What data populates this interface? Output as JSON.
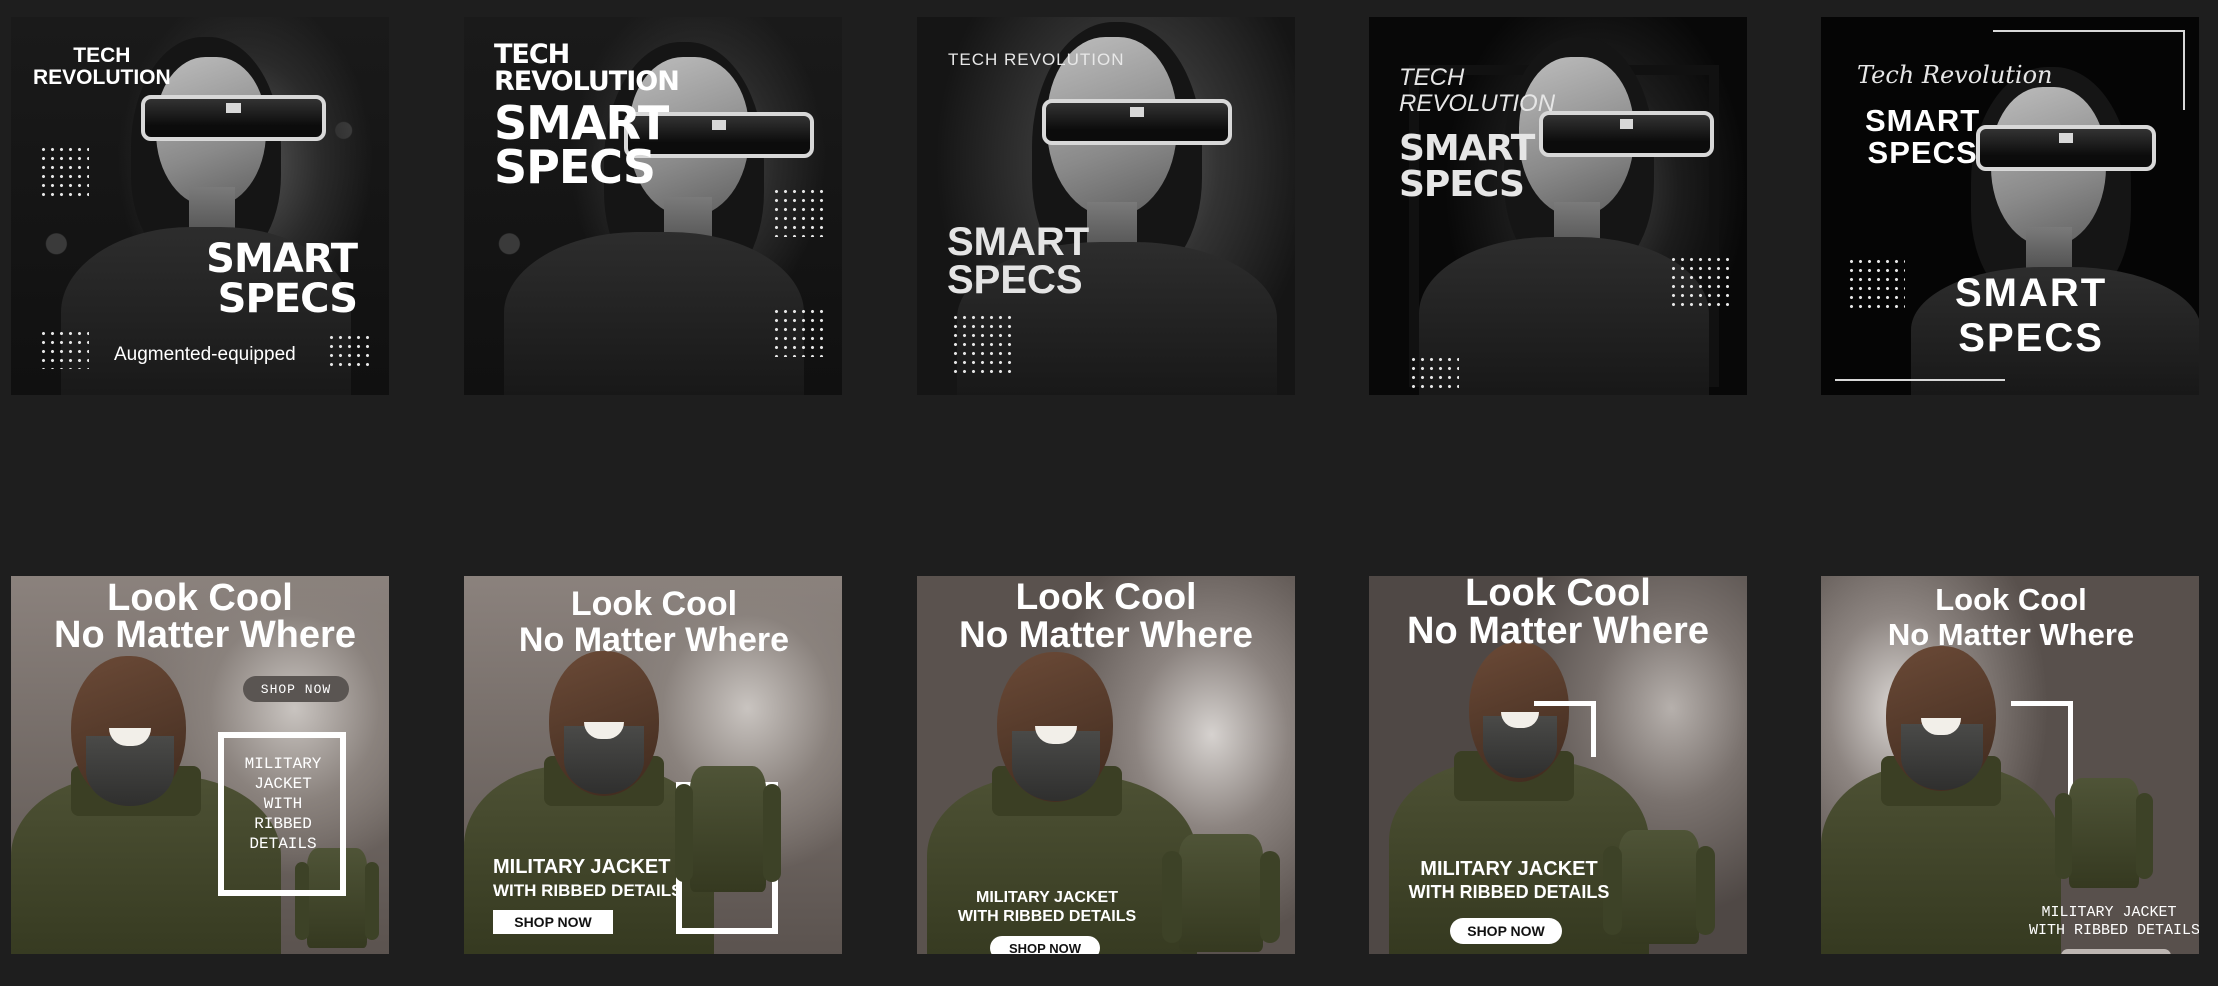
{
  "tech": {
    "eyebrow": "TECH",
    "eyebrow_line2": "REVOLUTION",
    "eyebrow_full": "TECH REVOLUTION",
    "script_eyebrow": "Tech Revolution",
    "headline_line1": "SMART",
    "headline_line2": "SPECS",
    "tagline": "Augmented-equipped"
  },
  "fashion": {
    "headline_line1": "Look Cool",
    "headline_line2": "No Matter Where",
    "cta": "SHOP NOW",
    "product_line1": "MILITARY JACKET",
    "product_line2": "WITH RIBBED DETAILS",
    "product_stacked": [
      "MILITARY",
      "JACKET",
      "WITH",
      "RIBBED",
      "DETAILS"
    ]
  },
  "colors": {
    "page_background": "#1e1e1e",
    "text": "#ffffff",
    "button_bg": "#ffffff",
    "button_text": "#111111",
    "pill_bg": "#555050"
  }
}
